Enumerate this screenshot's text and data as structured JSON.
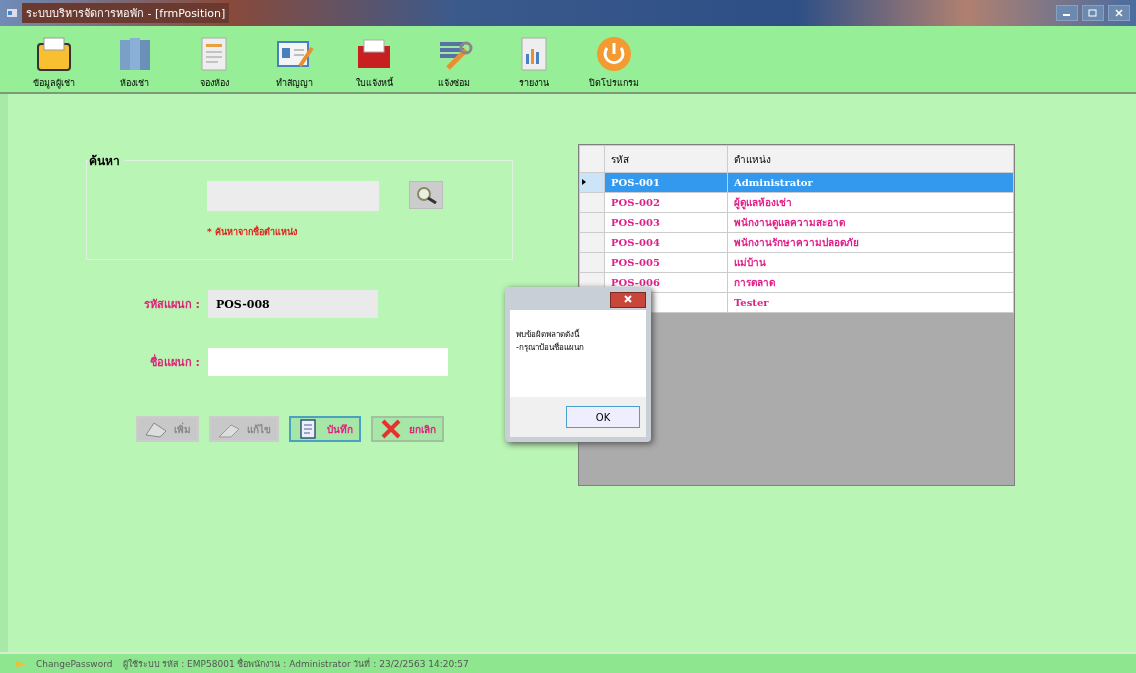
{
  "window": {
    "title": "ระบบบริหารจัดการหอพัก - [frmPosition]"
  },
  "toolbar": [
    {
      "kind": "folder",
      "label": "ข้อมูลผู้เช่า"
    },
    {
      "kind": "binders",
      "label": "ห้องเช่า"
    },
    {
      "kind": "document",
      "label": "จองห้อง"
    },
    {
      "kind": "card",
      "label": "ทำสัญญา"
    },
    {
      "kind": "redfolder",
      "label": "ใบแจ้งหนี้"
    },
    {
      "kind": "tools",
      "label": "แจ้งซ่อม"
    },
    {
      "kind": "report",
      "label": "รายงาน"
    },
    {
      "kind": "power",
      "label": "ปิดโปรแกรม"
    }
  ],
  "search": {
    "title": "ค้นหา",
    "hint": "* ค้นหาจากชื่อตำแหน่ง"
  },
  "form": {
    "fields": [
      {
        "label": "รหัสแผนก :",
        "value": "POS-008",
        "readonly": true
      },
      {
        "label": "ชื่อแผนก :",
        "readonly": false
      }
    ],
    "buttons": [
      {
        "kind": "add",
        "label": "เพิ่ม",
        "disabled": true
      },
      {
        "kind": "edit",
        "label": "แก้ไข",
        "disabled": true
      },
      {
        "kind": "save",
        "label": "บันทึก",
        "disabled": false
      },
      {
        "kind": "cancel",
        "label": "ยกเลิก",
        "disabled": false
      }
    ]
  },
  "table": {
    "columns": [
      "รหัส",
      "ตำแหน่ง"
    ],
    "rows": [
      {
        "code": "POS-001",
        "name": "Administrator",
        "selected": true
      },
      {
        "code": "POS-002",
        "name": "ผู้ดูแลห้องเช่า",
        "selected": false
      },
      {
        "code": "POS-003",
        "name": "พนักงานดูแลความสะอาด",
        "selected": false
      },
      {
        "code": "POS-004",
        "name": "พนักงานรักษาความปลอดภัย",
        "selected": false
      },
      {
        "code": "POS-005",
        "name": "แม่บ้าน",
        "selected": false
      },
      {
        "code": "POS-006",
        "name": "การตลาด",
        "selected": false
      },
      {
        "name": "Tester",
        "selected": false
      }
    ]
  },
  "dialog": {
    "message": [
      "พบข้อผิดพลาดดังนี้",
      "-กรุณาป้อนชื่อแผนก"
    ],
    "button": "OK"
  },
  "status_bar": [
    "ChangePassword",
    "ผู้ใช้ระบบ รหัส : EMP58001 ชื่อพนักงาน : Administrator วันที่ : 23/2/2563 14:20:57"
  ]
}
